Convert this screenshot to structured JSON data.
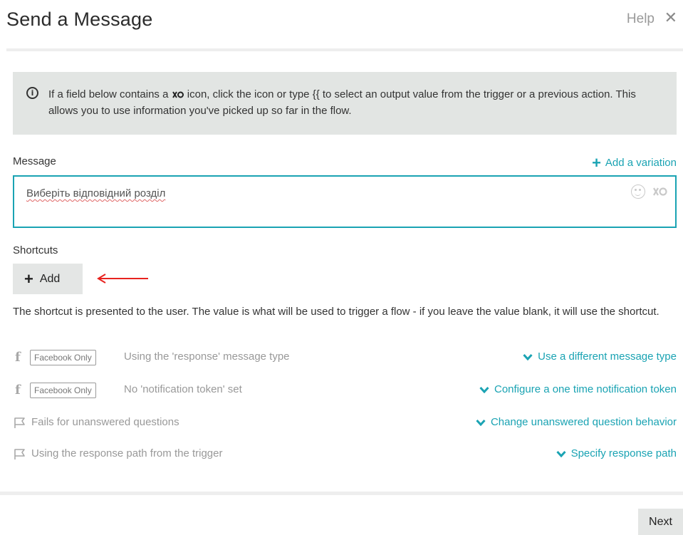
{
  "header": {
    "title": "Send a Message",
    "help_label": "Help",
    "close_label": "✕"
  },
  "info": {
    "text_before_icon": "If a field below contains a ",
    "text_after_icon": " icon, click the icon or type {{ to select an output value from the trigger or a previous action. This allows you to use information you've picked up so far in the flow."
  },
  "message": {
    "label": "Message",
    "add_variation_label": "Add a variation",
    "value": "Виберіть відповідний розділ"
  },
  "shortcuts": {
    "label": "Shortcuts",
    "add_label": "Add",
    "description": "The shortcut is presented to the user. The value is what will be used to trigger a flow - if you leave the value blank, it will use the shortcut."
  },
  "settings": [
    {
      "icon": "facebook-icon",
      "icon_glyph": "f",
      "badge": "Facebook Only",
      "text": "Using the 'response' message type",
      "action": "Use a different message type"
    },
    {
      "icon": "facebook-icon",
      "icon_glyph": "f",
      "badge": "Facebook Only",
      "text": "No 'notification token' set",
      "action": "Configure a one time notification token"
    },
    {
      "icon": "flag-icon",
      "badge": "",
      "text": "Fails for unanswered questions",
      "action": "Change unanswered question behavior"
    },
    {
      "icon": "flag-icon",
      "badge": "",
      "text": "Using the response path from the trigger",
      "action": "Specify response path"
    }
  ],
  "footer": {
    "next_label": "Next"
  },
  "colors": {
    "accent": "#1aa3b3",
    "info_bg": "#e2e5e3",
    "button_bg": "#e4e6e5",
    "annotation_arrow": "#e8231f"
  }
}
